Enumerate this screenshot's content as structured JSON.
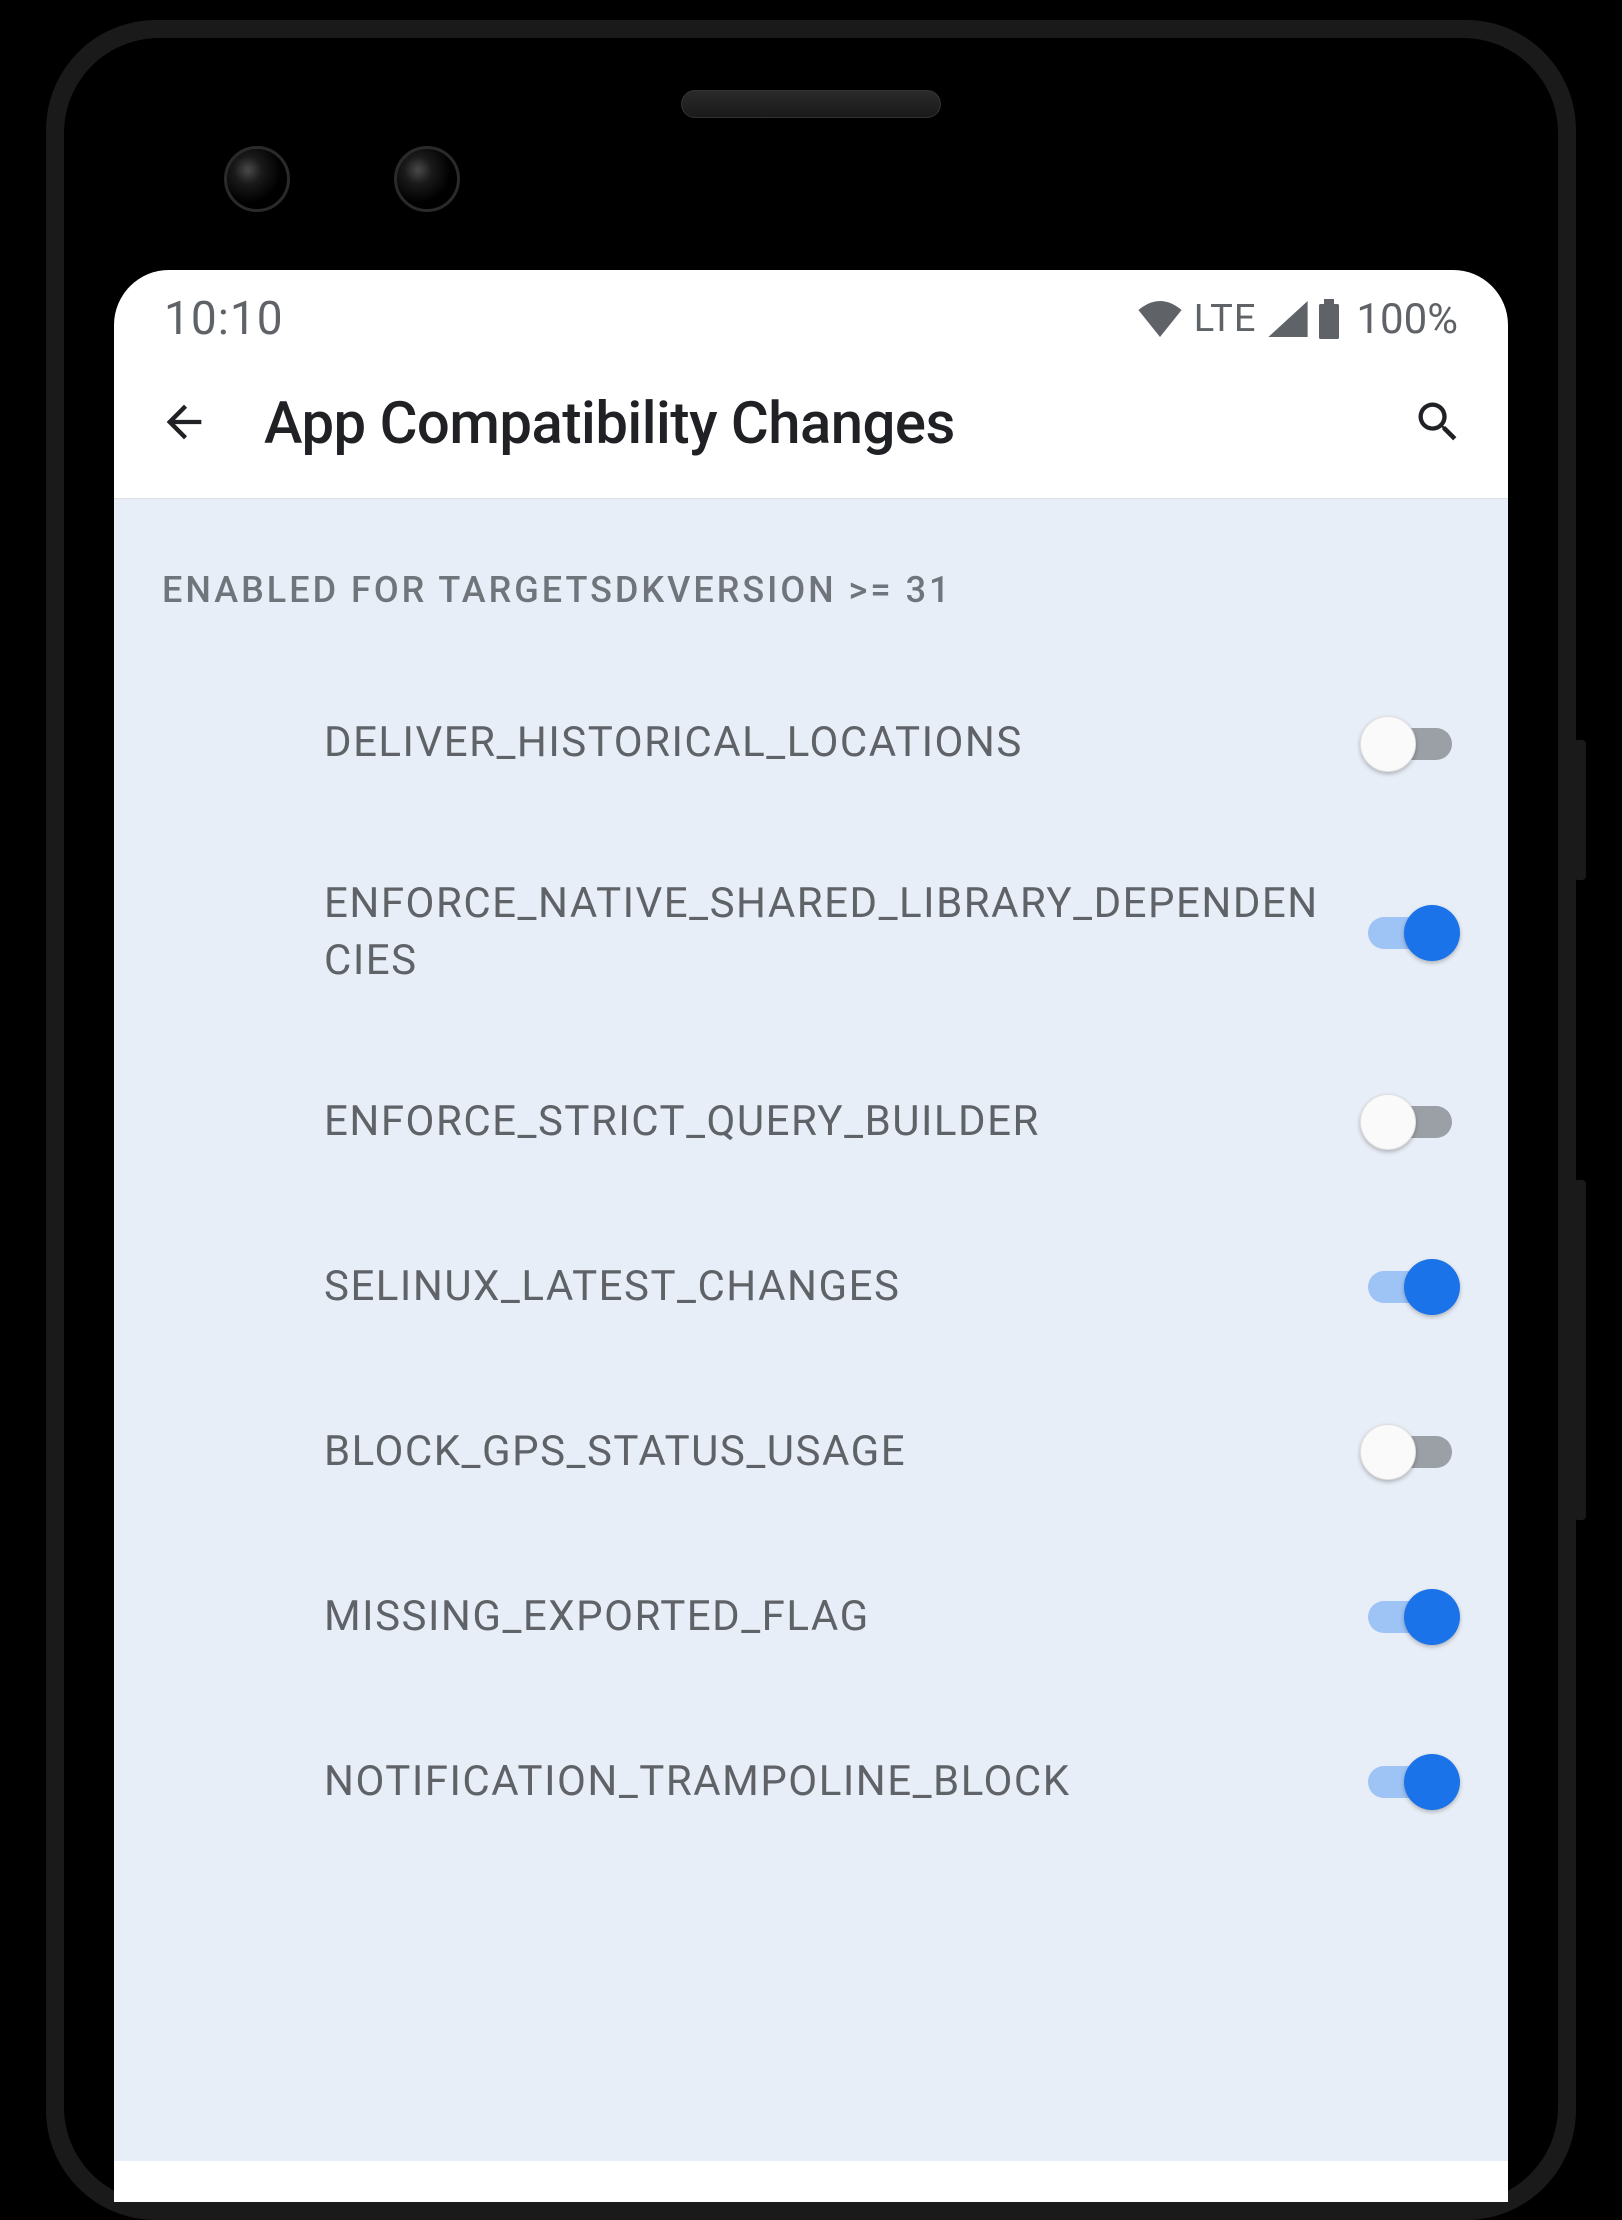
{
  "status_bar": {
    "time": "10:10",
    "network": "LTE",
    "battery": "100%"
  },
  "header": {
    "title": "App Compatibility Changes"
  },
  "section": {
    "title": "ENABLED FOR TARGETSDKVERSION >= 31"
  },
  "settings": [
    {
      "label": "DELIVER_HISTORICAL_LOCATIONS",
      "enabled": false
    },
    {
      "label": "ENFORCE_NATIVE_SHARED_LIBRARY_DEPENDENCIES",
      "enabled": true
    },
    {
      "label": "ENFORCE_STRICT_QUERY_BUILDER",
      "enabled": false
    },
    {
      "label": "SELINUX_LATEST_CHANGES",
      "enabled": true
    },
    {
      "label": "BLOCK_GPS_STATUS_USAGE",
      "enabled": false
    },
    {
      "label": "MISSING_EXPORTED_FLAG",
      "enabled": true
    },
    {
      "label": "NOTIFICATION_TRAMPOLINE_BLOCK",
      "enabled": true
    }
  ]
}
